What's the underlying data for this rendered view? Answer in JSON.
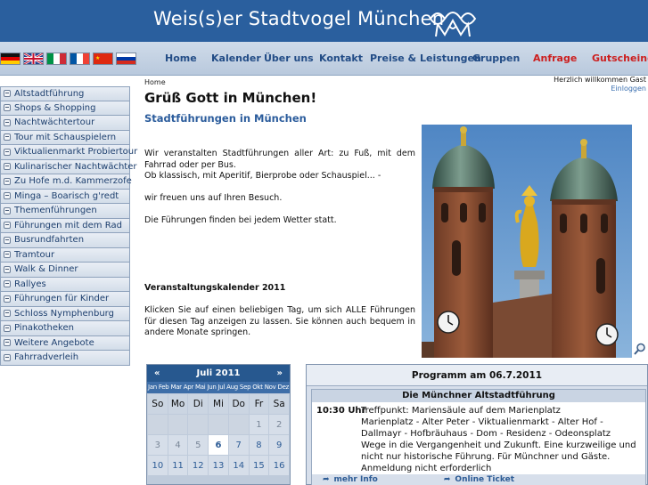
{
  "header": {
    "title": "Weis(s)er Stadtvogel München",
    "logo_icon": "doves-logo-icon"
  },
  "languages": [
    "german-flag-icon",
    "english-flag-icon",
    "italian-flag-icon",
    "french-flag-icon",
    "chinese-flag-icon",
    "russian-flag-icon"
  ],
  "nav": {
    "items": [
      {
        "label": "Home"
      },
      {
        "label": "Kalender"
      },
      {
        "label": "Über uns"
      },
      {
        "label": "Kontakt"
      },
      {
        "label": "Preise & Leistungen"
      },
      {
        "label": "Gruppen"
      },
      {
        "label": "Anfrage"
      },
      {
        "label": "Gutscheine"
      }
    ],
    "highlight_color": "#cc1f1f"
  },
  "sidebar": {
    "items": [
      {
        "label": "Altstadtführung"
      },
      {
        "label": "Shops & Shopping"
      },
      {
        "label": "Nachtwächtertour"
      },
      {
        "label": "Tour mit Schauspielern"
      },
      {
        "label": "Viktualienmarkt Probiertour"
      },
      {
        "label": "Kulinarischer Nachtwächter"
      },
      {
        "label": "Zu Hofe m.d. Kammerzofe"
      },
      {
        "label": "Minga – Boarisch g'redt"
      },
      {
        "label": "Themenführungen"
      },
      {
        "label": "Führungen mit dem Rad"
      },
      {
        "label": "Busrundfahrten"
      },
      {
        "label": "Tramtour"
      },
      {
        "label": "Walk & Dinner"
      },
      {
        "label": "Rallyes"
      },
      {
        "label": "Führungen für Kinder"
      },
      {
        "label": "Schloss Nymphenburg"
      },
      {
        "label": "Pinakotheken"
      },
      {
        "label": "Weitere Angebote"
      },
      {
        "label": "Fahrradverleih"
      }
    ]
  },
  "breadcrumb": "Home",
  "welcome": {
    "greeting": "Herzlich willkommen Gast",
    "login": "Einloggen"
  },
  "main": {
    "heading": "Grüß Gott in München!",
    "subheading": "Stadtführungen in München",
    "intro_1": "Wir veranstalten Stadtführungen aller Art: zu Fuß, mit dem Fahrrad oder per Bus.",
    "intro_2": "Ob klassisch, mit Aperitif, Bierprobe oder Schauspiel... -",
    "intro_3": "wir freuen uns auf Ihren Besuch.",
    "intro_4": "Die Führungen finden bei jedem Wetter statt.",
    "calendar_heading": "Veranstaltungskalender 2011",
    "calendar_text": "Klicken Sie auf einen beliebigen Tag, um sich ALLE Führungen für diesen Tag anzeigen zu lassen. Sie können auch bequem in andere Monate springen."
  },
  "calendar": {
    "prev": "«",
    "next": "»",
    "month": "Juli 2011",
    "months": [
      "Jan",
      "Feb",
      "Mar",
      "Apr",
      "Mai",
      "Jun",
      "Jul",
      "Aug",
      "Sep",
      "Okt",
      "Nov",
      "Dez"
    ],
    "weekdays": [
      "So",
      "Mo",
      "Di",
      "Mi",
      "Do",
      "Fr",
      "Sa"
    ],
    "week1": [
      "",
      "",
      "",
      "",
      "",
      "1",
      "2"
    ],
    "week2": [
      "3",
      "4",
      "5",
      "6",
      "7",
      "8",
      "9"
    ],
    "week3": [
      "10",
      "11",
      "12",
      "13",
      "14",
      "15",
      "16"
    ],
    "today": "6"
  },
  "program": {
    "title": "Programm am 06.7.2011",
    "event_name": "Die Münchner Altstadtführung",
    "time": "10:30 Uhr",
    "line_1": "Treffpunkt: Mariensäule auf dem Marienplatz",
    "line_2": "Marienplatz - Alter Peter - Viktualienmarkt - Alter Hof - Dallmayr - Hofbräuhaus - Dom - Residenz - Odeonsplatz",
    "line_3": "Wege in die Vergangenheit und Zukunft. Eine kurzweilige und nicht nur historische Führung. Für Münchner und Gäste.",
    "line_4": "Anmeldung nicht erforderlich",
    "more_info": "mehr Info",
    "online_ticket": "Online Ticket"
  }
}
